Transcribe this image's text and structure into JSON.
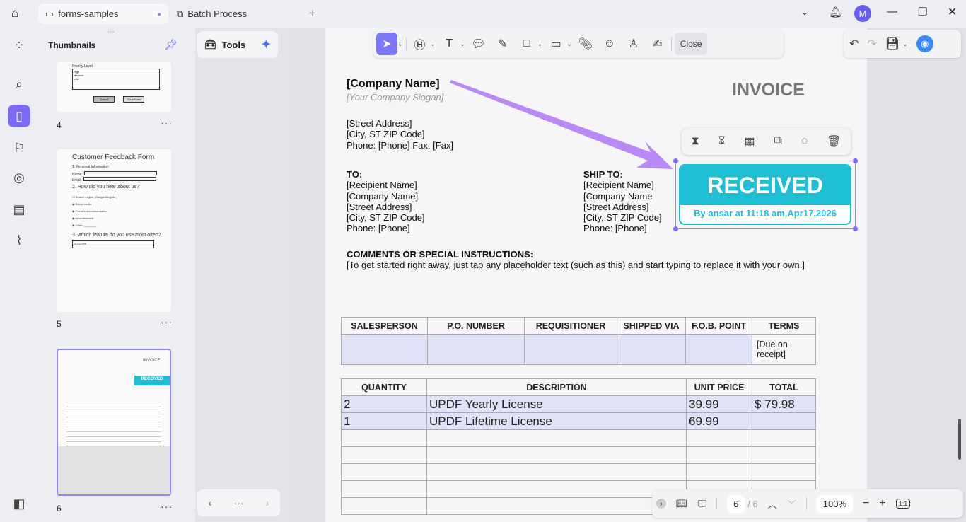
{
  "tabs": [
    {
      "label": "forms-samples",
      "icon": "comment-icon"
    },
    {
      "label": "Batch Process",
      "icon": "batch-icon"
    }
  ],
  "window": {
    "avatar": "M"
  },
  "thumbnails": {
    "title": "Thumbnails",
    "pages": [
      {
        "number": "4",
        "content": {
          "priority_label": "Priority Level:",
          "options": [
            "High",
            "Medium",
            "Low"
          ],
          "buttons": [
            "Submit",
            "Clear Form"
          ]
        }
      },
      {
        "number": "5",
        "content": {
          "title": "Customer Feedback Form",
          "s1": "1. Personal Information",
          "name": "Name:",
          "email": "Email:",
          "s2": "2. How did you hear about us?",
          "opts": [
            "Search engine (Google/Bing/etc.)",
            "Social media",
            "Friend's recommendation",
            "Advertisement",
            "Other: ________"
          ],
          "s3": "3. Which feature do you use most often?",
          "select": "Convert PDF"
        }
      },
      {
        "number": "6",
        "content": {
          "title": "INVOICE",
          "stamp": "RECEIVED"
        }
      }
    ]
  },
  "tools": {
    "label": "Tools"
  },
  "toolbar": {
    "close": "Close"
  },
  "invoice": {
    "company": "[Company Name]",
    "slogan": "[Your Company Slogan]",
    "title": "INVOICE",
    "address": [
      "[Street Address]",
      "[City, ST ZIP Code]",
      "Phone: [Phone]  Fax: [Fax]"
    ],
    "to_label": "TO:",
    "to": [
      "[Recipient Name]",
      "[Company Name]",
      "[Street Address]",
      "[City, ST ZIP Code]",
      "Phone: [Phone]"
    ],
    "ship_label": "SHIP TO:",
    "ship": [
      "[Recipient Name]",
      "[Company Name",
      "[Street Address]",
      "[City, ST ZIP Code]",
      "Phone: [Phone]"
    ],
    "comments_label": "COMMENTS OR SPECIAL INSTRUCTIONS:",
    "comments": "[To get started right away, just tap any placeholder text (such as this) and start typing to replace it with your own.]",
    "table1": {
      "headers": [
        "SALESPERSON",
        "P.O. NUMBER",
        "REQUISITIONER",
        "SHIPPED VIA",
        "F.O.B. POINT",
        "TERMS"
      ],
      "row": [
        "",
        "",
        "",
        "",
        "",
        "[Due on receipt]"
      ]
    },
    "table2": {
      "headers": [
        "QUANTITY",
        "DESCRIPTION",
        "UNIT PRICE",
        "TOTAL"
      ],
      "rows": [
        [
          "2",
          "UPDF Yearly License",
          "39.99",
          "$ 79.98"
        ],
        [
          "1",
          "UPDF Lifetime License",
          "69.99",
          ""
        ]
      ]
    }
  },
  "stamp": {
    "title": "RECEIVED",
    "subtitle": "By ansar at 11:18 am,Apr17,2026",
    "color": "#1ebfd4"
  },
  "pagenav": {
    "current": "6",
    "total": "/ 6",
    "zoom": "100%",
    "fit": "1:1"
  },
  "colors": {
    "accent": "#7b6cf6",
    "arrow": "#b98af5"
  }
}
